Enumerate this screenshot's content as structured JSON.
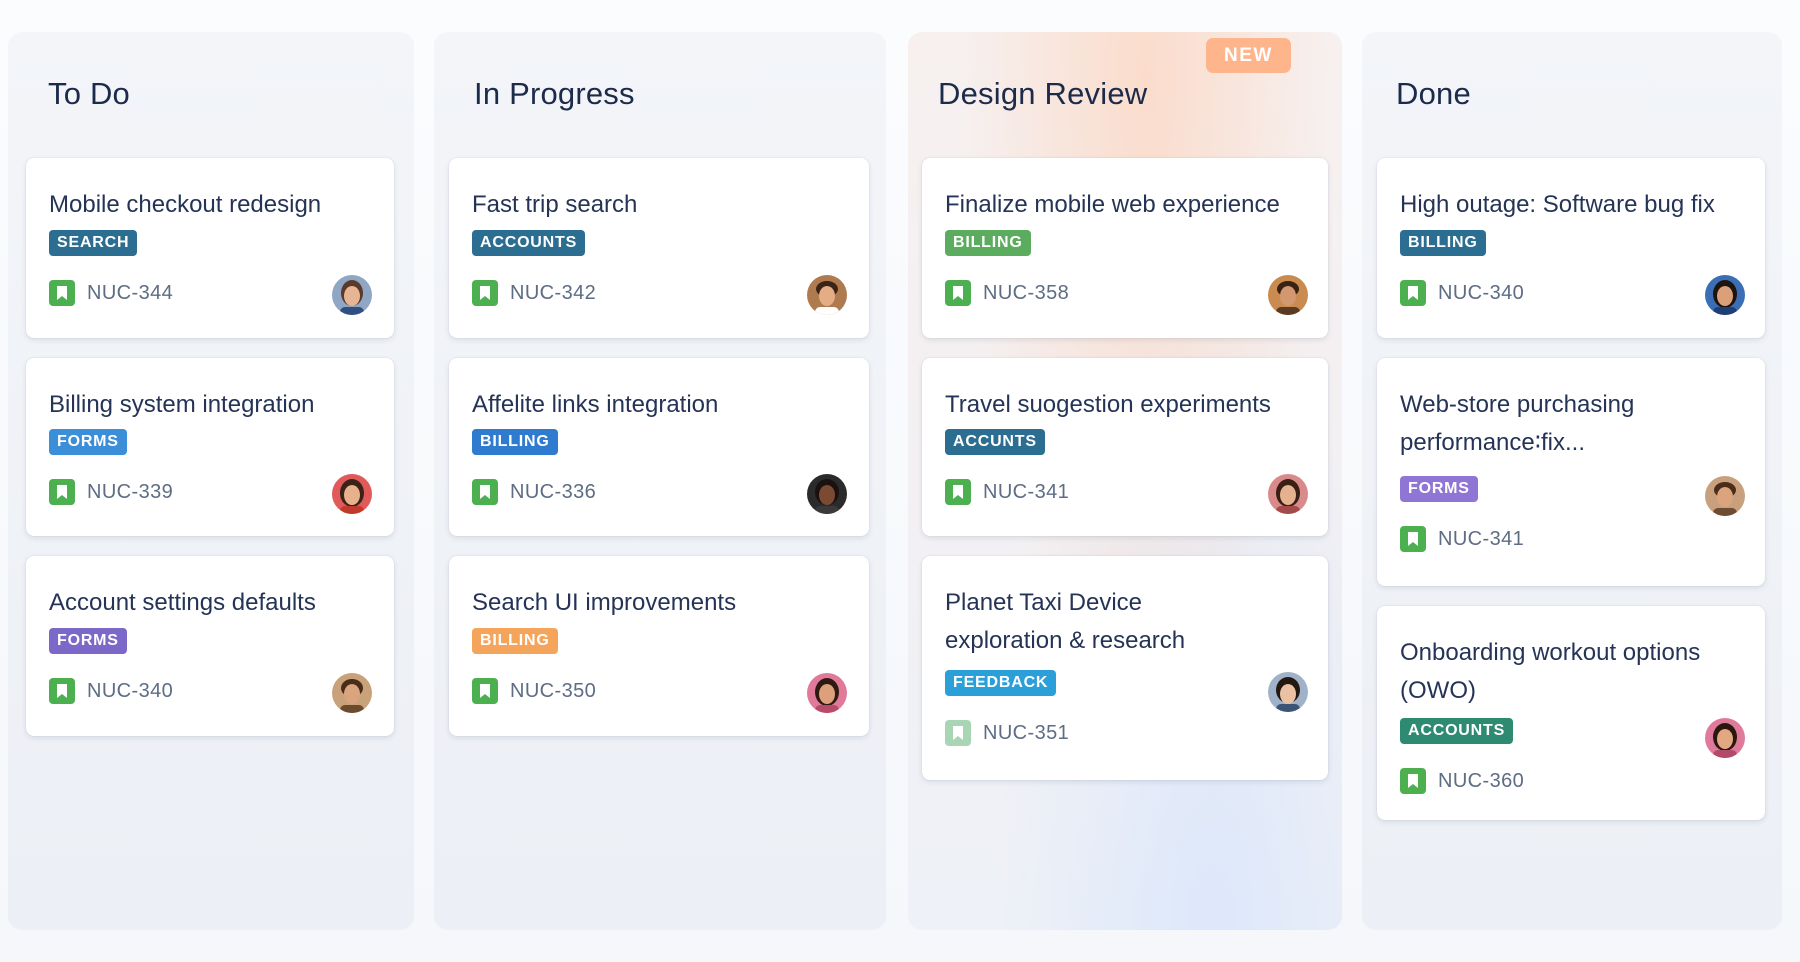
{
  "colors": {
    "search": "#2c6e91",
    "accounts": "#2c6e91",
    "forms": "#7b68c8",
    "billing_green": "#5bac5f",
    "billing_blue": "#2f7bd0",
    "billing_orange": "#f5a45b",
    "billing_teal": "#2c6e91",
    "accounts_dark": "#2c6e91",
    "accounts_green": "#2e8b72",
    "feedback": "#2a9fd8",
    "story_icon": "#4caf50",
    "new_badge": "#ffb58c"
  },
  "columns": [
    {
      "title": "To Do",
      "cards": [
        {
          "title": "Mobile checkout redesign",
          "tag": "SEARCH",
          "key": "NUC-344",
          "icon": "bookmark-icon"
        },
        {
          "title": "Billing system integration",
          "tag": "FORMS",
          "key": "NUC-339",
          "icon": "bookmark-icon"
        },
        {
          "title": "Account settings defaults",
          "tag": "FORMS",
          "key": "NUC-340",
          "icon": "bookmark-icon"
        }
      ]
    },
    {
      "title": "In Progress",
      "cards": [
        {
          "title": "Fast trip search",
          "tag": "ACCOUNTS",
          "key": "NUC-342",
          "icon": "bookmark-icon"
        },
        {
          "title": "Affelite links integration",
          "tag": "BILLING",
          "key": "NUC-336",
          "icon": "bookmark-icon"
        },
        {
          "title": "Search UI improvements",
          "tag": "BILLING",
          "key": "NUC-350",
          "icon": "bookmark-icon"
        }
      ]
    },
    {
      "title": "Design Review",
      "badge": "NEW",
      "cards": [
        {
          "title": "Finalize mobile web experience",
          "tag": "BILLING",
          "key": "NUC-358",
          "icon": "bookmark-icon"
        },
        {
          "title": "Travel suogestion experiments",
          "tag": "ACCUNTS",
          "key": "NUC-341",
          "icon": "bookmark-icon"
        },
        {
          "title_line1": "Planet Taxi Device",
          "title_line2": "exploration & research",
          "tag": "FEEDBACK",
          "key": "NUC-351",
          "icon": "bookmark-icon"
        }
      ]
    },
    {
      "title": "Done",
      "cards": [
        {
          "title": "High outage: Software bug fix",
          "tag": "BILLING",
          "key": "NUC-340",
          "icon": "bookmark-icon"
        },
        {
          "title_line1": "Web-store purchasing",
          "title_line2": "performance∶fix...",
          "tag": "FORMS",
          "key": "NUC-341",
          "icon": "bookmark-icon"
        },
        {
          "title_line1": "Onboarding workout options",
          "title_line2": "(OWO)",
          "tag": "ACCOUNTS",
          "key": "NUC-360",
          "icon": "bookmark-icon"
        }
      ]
    }
  ]
}
